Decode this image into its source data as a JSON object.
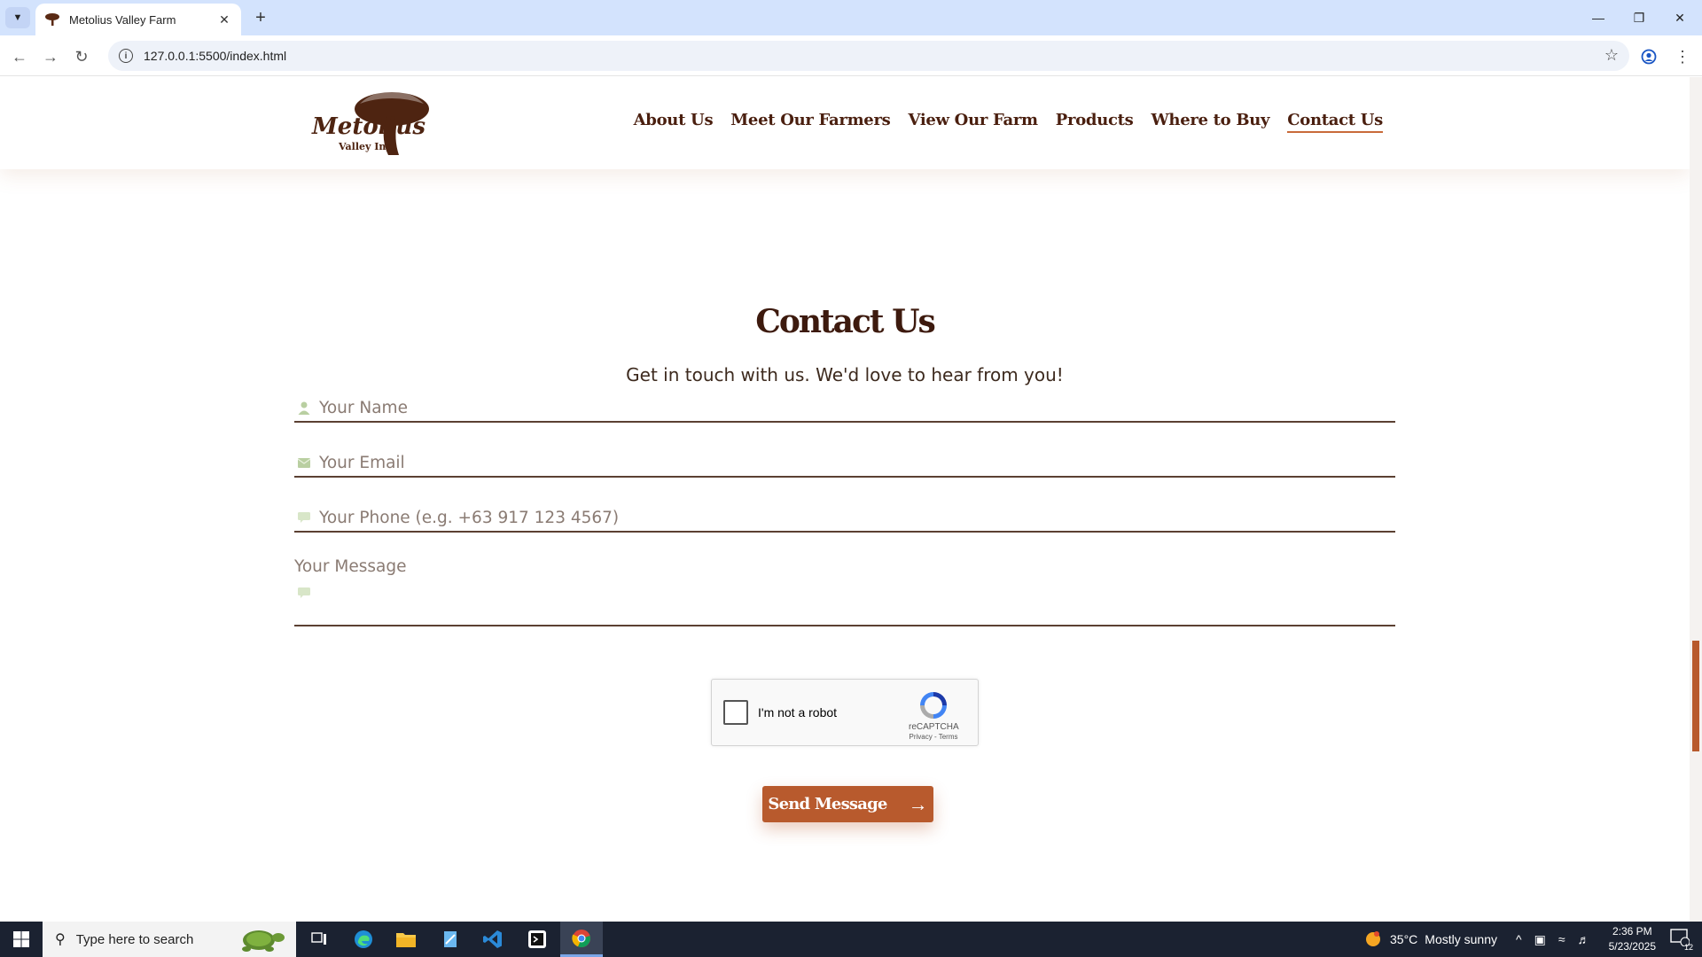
{
  "browser": {
    "tab_title": "Metolius Valley Farm",
    "url": "127.0.0.1:5500/index.html"
  },
  "site": {
    "logo_text_main": "Metolius",
    "logo_text_sub": "Valley Inc.",
    "nav": [
      {
        "label": "About Us"
      },
      {
        "label": "Meet Our Farmers"
      },
      {
        "label": "View Our Farm"
      },
      {
        "label": "Products"
      },
      {
        "label": "Where to Buy"
      },
      {
        "label": "Contact Us",
        "active": true
      }
    ]
  },
  "contact": {
    "title": "Contact Us",
    "subtitle": "Get in touch with us. We'd love to hear from you!",
    "name_placeholder": "Your Name",
    "email_placeholder": "Your Email",
    "phone_placeholder": "Your Phone (e.g. +63 917 123 4567)",
    "message_placeholder": "Your Message",
    "send_label": "Send Message"
  },
  "recaptcha": {
    "label": "I'm not a robot",
    "brand": "reCAPTCHA",
    "links": "Privacy - Terms"
  },
  "taskbar": {
    "search_placeholder": "Type here to search",
    "weather_temp": "35°C",
    "weather_desc": "Mostly sunny",
    "time": "2:36 PM",
    "date": "5/23/2025",
    "notifications": "12"
  },
  "colors": {
    "accent": "#b85a2d",
    "heading": "#3d1a0e",
    "nav_text": "#4a1f0f"
  }
}
